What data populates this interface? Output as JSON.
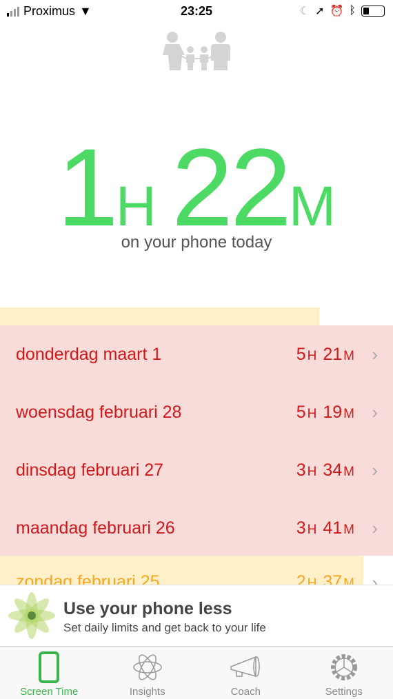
{
  "status_bar": {
    "carrier": "Proximus",
    "time": "23:25",
    "battery_level": 0.25
  },
  "hero": {
    "hours": "1",
    "hours_unit": "H",
    "minutes": "22",
    "minutes_unit": "M",
    "caption": "on your phone today"
  },
  "days": [
    {
      "date": "donderdag maart 1",
      "hours": "5",
      "minutes": "21",
      "h_unit": "H",
      "m_unit": "M",
      "level": "over"
    },
    {
      "date": "woensdag februari 28",
      "hours": "5",
      "minutes": "19",
      "h_unit": "H",
      "m_unit": "M",
      "level": "over"
    },
    {
      "date": "dinsdag februari 27",
      "hours": "3",
      "minutes": "34",
      "h_unit": "H",
      "m_unit": "M",
      "level": "over"
    },
    {
      "date": "maandag februari 26",
      "hours": "3",
      "minutes": "41",
      "h_unit": "H",
      "m_unit": "M",
      "level": "over"
    },
    {
      "date": "zondag februari 25",
      "hours": "2",
      "minutes": "37",
      "h_unit": "H",
      "m_unit": "M",
      "level": "warning"
    }
  ],
  "banner": {
    "title": "Use your phone less",
    "subtitle": "Set daily limits and get back to your life"
  },
  "tabs": [
    {
      "label": "Screen Time",
      "icon": "phone-icon",
      "active": true
    },
    {
      "label": "Insights",
      "icon": "atom-icon",
      "active": false
    },
    {
      "label": "Coach",
      "icon": "megaphone-icon",
      "active": false
    },
    {
      "label": "Settings",
      "icon": "gear-icon",
      "active": false
    }
  ],
  "colors": {
    "accent": "#4cd964",
    "over": "#d0191b",
    "over_bg": "#f8dcda",
    "warning": "#f5a623",
    "warning_bg": "#fff0c9"
  }
}
